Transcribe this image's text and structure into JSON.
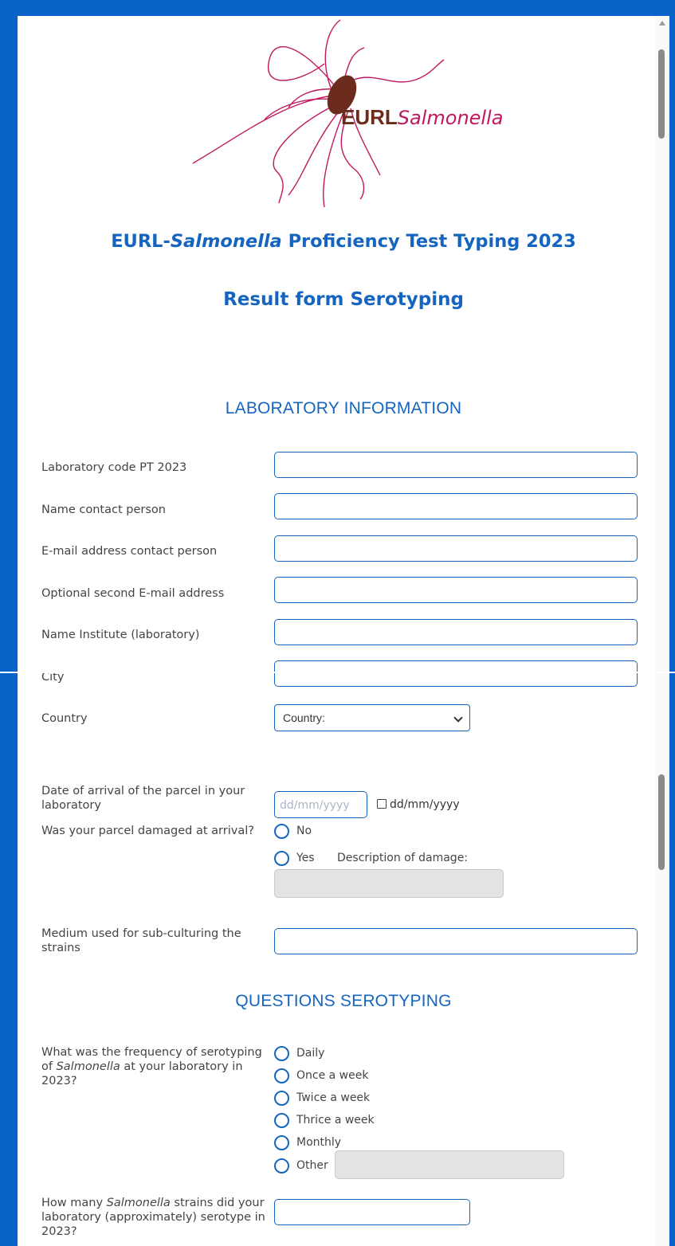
{
  "logo": {
    "text_bold": "EURL",
    "text_italic": "Salmonella"
  },
  "title": {
    "line1_prefix": "EURL-",
    "line1_italic": "Salmonella",
    "line1_suffix": " Proficiency Test Typing 2023",
    "line2": "Result form Serotyping"
  },
  "lab_section": {
    "heading": "LABORATORY INFORMATION",
    "fields": [
      {
        "label": "Laboratory code PT 2023",
        "value": ""
      },
      {
        "label": "Name contact person",
        "value": ""
      },
      {
        "label": "E-mail address contact person",
        "value": ""
      },
      {
        "label": "Optional second E-mail address",
        "value": ""
      },
      {
        "label": "Name Institute (laboratory)",
        "value": ""
      },
      {
        "label": "City",
        "value": ""
      }
    ],
    "country": {
      "label": "Country",
      "selected": "Country:"
    },
    "arrival": {
      "label": "Date of arrival of the parcel in your laboratory",
      "placeholder": "dd/mm/yyyy",
      "display": "dd/mm/yyyy"
    },
    "damaged": {
      "label": "Was your parcel damaged at arrival?",
      "options": [
        "No",
        "Yes"
      ],
      "description_label": "Description of damage:"
    },
    "medium": {
      "label": "Medium used for sub-culturing the strains",
      "value": ""
    }
  },
  "questions_section": {
    "heading": "QUESTIONS SEROTYPING",
    "frequency": {
      "label_prefix": "What was the frequency of serotyping of ",
      "label_italic": "Salmonella",
      "label_suffix": " at your laboratory in 2023?",
      "options": [
        "Daily",
        "Once a week",
        "Twice a week",
        "Thrice a week",
        "Monthly",
        "Other"
      ]
    },
    "strains": {
      "label_prefix": "How many ",
      "label_italic": "Salmonella",
      "label_suffix": " strains did your laboratory (approximately) serotype in 2023?",
      "value": ""
    }
  },
  "colors": {
    "frame": "#0a63c9",
    "accent": "#1565c0",
    "logo_brown": "#6b2b1d",
    "logo_magenta": "#c0185f"
  }
}
